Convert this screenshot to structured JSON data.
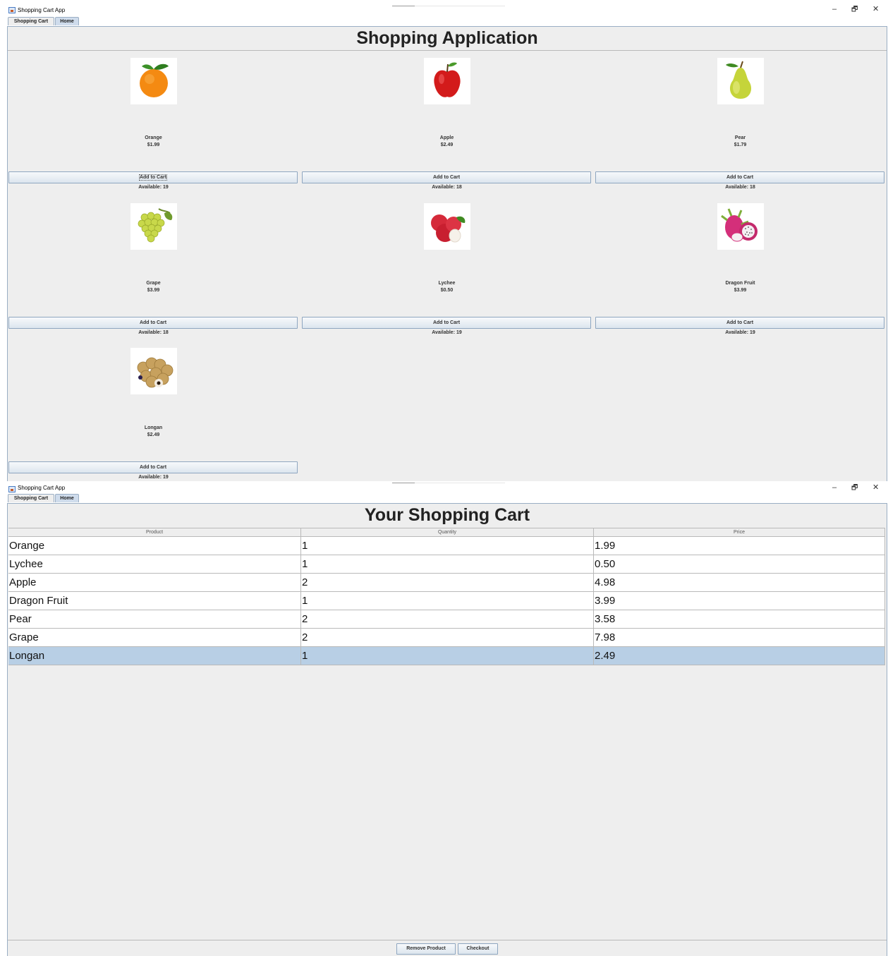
{
  "window_top": {
    "title": "Shopping Cart App",
    "controls": {
      "minimize": "–",
      "maximize": "🗗",
      "close": "✕"
    },
    "tabs": [
      {
        "label": "Shopping Cart",
        "selected": true
      },
      {
        "label": "Home",
        "selected": false
      }
    ],
    "heading": "Shopping Application",
    "add_button_label": "Add to Cart",
    "products": [
      {
        "name": "Orange",
        "price": "$1.99",
        "available": "Available: 19",
        "icon": "orange-icon"
      },
      {
        "name": "Apple",
        "price": "$2.49",
        "available": "Available: 18",
        "icon": "apple-icon"
      },
      {
        "name": "Pear",
        "price": "$1.79",
        "available": "Available: 18",
        "icon": "pear-icon"
      },
      {
        "name": "Grape",
        "price": "$3.99",
        "available": "Available: 18",
        "icon": "grape-icon"
      },
      {
        "name": "Lychee",
        "price": "$0.50",
        "available": "Available: 19",
        "icon": "lychee-icon"
      },
      {
        "name": "Dragon Fruit",
        "price": "$3.99",
        "available": "Available: 19",
        "icon": "dragon-fruit-icon"
      },
      {
        "name": "Longan",
        "price": "$2.49",
        "available": "Available: 19",
        "icon": "longan-icon"
      }
    ]
  },
  "window_bottom": {
    "title": "Shopping Cart App",
    "controls": {
      "minimize": "–",
      "maximize": "🗗",
      "close": "✕"
    },
    "tabs": [
      {
        "label": "Shopping Cart",
        "selected": true
      },
      {
        "label": "Home",
        "selected": false
      }
    ],
    "heading": "Your Shopping Cart",
    "table": {
      "columns": [
        "Product",
        "Quantity",
        "Price"
      ],
      "rows": [
        {
          "product": "Orange",
          "quantity": "1",
          "price": "1.99",
          "selected": false
        },
        {
          "product": "Lychee",
          "quantity": "1",
          "price": "0.50",
          "selected": false
        },
        {
          "product": "Apple",
          "quantity": "2",
          "price": "4.98",
          "selected": false
        },
        {
          "product": "Dragon Fruit",
          "quantity": "1",
          "price": "3.99",
          "selected": false
        },
        {
          "product": "Pear",
          "quantity": "2",
          "price": "3.58",
          "selected": false
        },
        {
          "product": "Grape",
          "quantity": "2",
          "price": "7.98",
          "selected": false
        },
        {
          "product": "Longan",
          "quantity": "1",
          "price": "2.49",
          "selected": true
        }
      ]
    },
    "buttons": {
      "remove": "Remove Product",
      "checkout": "Checkout"
    }
  },
  "colors": {
    "panel_bg": "#eeeeee",
    "selected_row": "#b8cfe5",
    "tab_unselected": "#cfdcec",
    "border": "#9aaec4"
  }
}
